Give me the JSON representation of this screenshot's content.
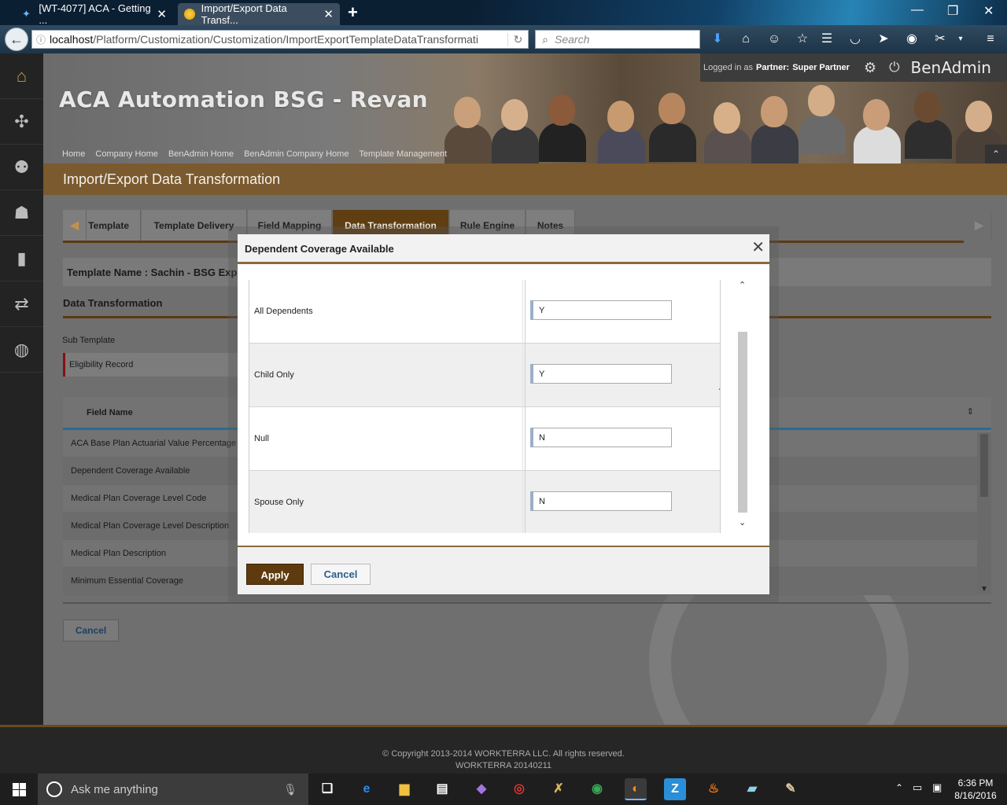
{
  "browser": {
    "tabs": [
      {
        "title": "[WT-4077] ACA - Getting ...",
        "active": false
      },
      {
        "title": "Import/Export Data Transf...",
        "active": true
      }
    ],
    "url_host": "localhost",
    "url_path": "/Platform/Customization/Customization/ImportExportTemplateDataTransformati",
    "search_placeholder": "Search"
  },
  "user_bar": {
    "logged_in_prefix": "Logged in as",
    "role": "Partner:",
    "user": "Super Partner",
    "brand": "BenAdmin"
  },
  "banner": {
    "site_title": "ACA Automation BSG - Revan",
    "breadcrumb": [
      "Home",
      "Company Home",
      "BenAdmin Home",
      "BenAdmin Company Home",
      "Template Management"
    ]
  },
  "page_title": "Import/Export Data Transformation",
  "step_tabs": [
    {
      "label": "Template",
      "active": false
    },
    {
      "label": "Template Delivery",
      "active": false
    },
    {
      "label": "Field Mapping",
      "active": false
    },
    {
      "label": "Data Transformation",
      "active": true
    },
    {
      "label": "Rule Engine",
      "active": false
    },
    {
      "label": "Notes",
      "active": false
    }
  ],
  "template_name": "Template Name : Sachin - BSG Exp",
  "section_title": "Data Transformation",
  "sub_template": {
    "label": "Sub Template",
    "value": "Eligibility Record"
  },
  "grid": {
    "header": "Field Name",
    "rows": [
      "ACA Base Plan Actuarial Value Percentage",
      "Dependent Coverage Available",
      "Medical Plan Coverage Level Code",
      "Medical Plan Coverage Level Description",
      "Medical Plan Description",
      "Minimum Essential Coverage"
    ]
  },
  "main_cancel": "Cancel",
  "modal": {
    "title": "Dependent Coverage Available",
    "rows": [
      {
        "label": "All Dependents",
        "value": "Y"
      },
      {
        "label": "Child Only",
        "value": "Y"
      },
      {
        "label": "Null",
        "value": "N"
      },
      {
        "label": "Spouse Only",
        "value": "N"
      }
    ],
    "apply": "Apply",
    "cancel": "Cancel"
  },
  "footer": {
    "copyright": "© Copyright 2013-2014 WORKTERRA LLC. All rights reserved.",
    "version": "WORKTERRA 20140211"
  },
  "taskbar": {
    "search_placeholder": "Ask me anything",
    "time": "6:36 PM",
    "date": "8/16/2016"
  },
  "colors": {
    "accent_brown": "#5e3a0e",
    "page_title_bar": "#7a5a2e",
    "grid_header_rule": "#2a6a92"
  }
}
